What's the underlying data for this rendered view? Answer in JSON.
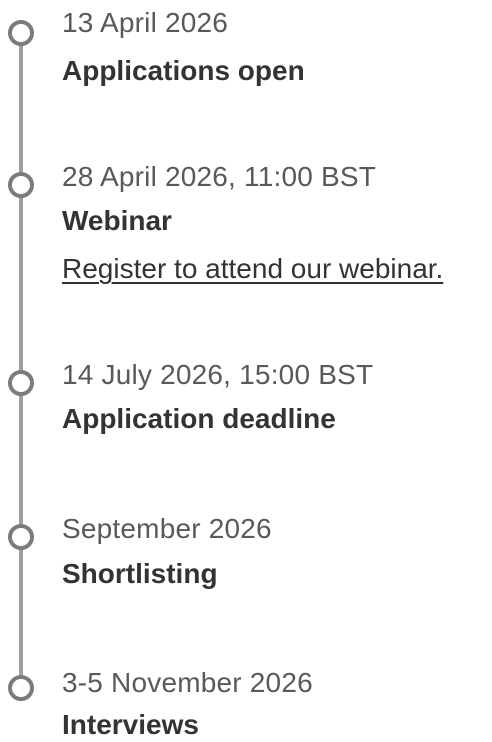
{
  "timeline": {
    "events": [
      {
        "date": "13 April 2026",
        "title": "Applications open"
      },
      {
        "date": "28 April 2026, 11:00 BST",
        "title": "Webinar",
        "link": "Register to attend our webinar."
      },
      {
        "date": "14 July 2026, 15:00 BST",
        "title": "Application deadline"
      },
      {
        "date": "September 2026",
        "title": "Shortlisting"
      },
      {
        "date": "3-5 November 2026",
        "title": "Interviews"
      }
    ]
  },
  "colors": {
    "line": "#a0a0a0",
    "marker": "#7b7b7b",
    "date_text": "#595959",
    "title_text": "#333333"
  }
}
